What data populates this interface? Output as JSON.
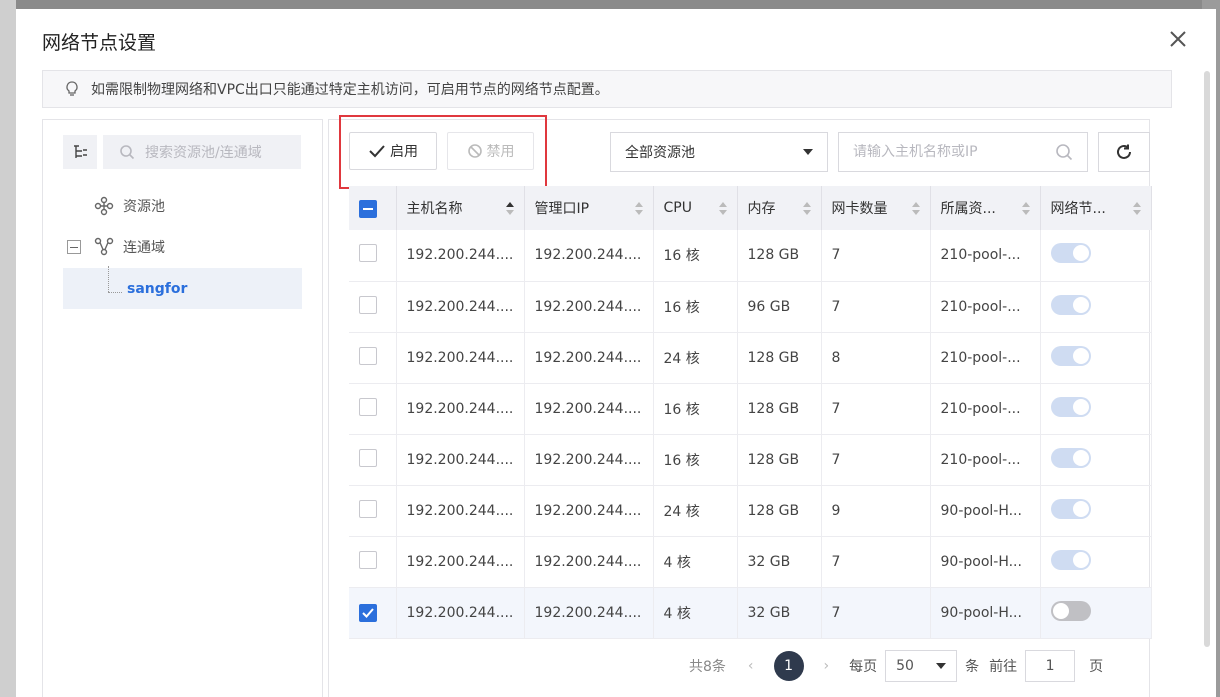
{
  "dialog": {
    "title": "网络节点设置",
    "notice": "如需限制物理网络和VPC出口只能通过特定主机访问，可启用节点的网络节点配置。"
  },
  "tree": {
    "search_placeholder": "搜索资源池/连通域",
    "items": [
      {
        "label": "资源池",
        "icon": "resource-pool-icon"
      },
      {
        "label": "连通域",
        "icon": "connectivity-domain-icon"
      },
      {
        "label": "sangfor",
        "selected": true
      }
    ]
  },
  "toolbar": {
    "enable_label": "启用",
    "disable_label": "禁用",
    "pool_select": "全部资源池",
    "search_placeholder": "请输入主机名称或IP"
  },
  "table": {
    "columns": [
      "主机名称",
      "管理口IP",
      "CPU",
      "内存",
      "网卡数量",
      "所属资...",
      "网络节..."
    ],
    "rows": [
      {
        "host": "192.200.244....",
        "ip": "192.200.244....",
        "cpu": "16 核",
        "mem": "128 GB",
        "nic": "7",
        "pool": "210-pool-...",
        "enabled": true,
        "checked": false
      },
      {
        "host": "192.200.244....",
        "ip": "192.200.244....",
        "cpu": "16 核",
        "mem": "96 GB",
        "nic": "7",
        "pool": "210-pool-...",
        "enabled": true,
        "checked": false
      },
      {
        "host": "192.200.244....",
        "ip": "192.200.244....",
        "cpu": "24 核",
        "mem": "128 GB",
        "nic": "8",
        "pool": "210-pool-...",
        "enabled": true,
        "checked": false
      },
      {
        "host": "192.200.244....",
        "ip": "192.200.244....",
        "cpu": "16 核",
        "mem": "128 GB",
        "nic": "7",
        "pool": "210-pool-...",
        "enabled": true,
        "checked": false
      },
      {
        "host": "192.200.244....",
        "ip": "192.200.244....",
        "cpu": "16 核",
        "mem": "128 GB",
        "nic": "7",
        "pool": "210-pool-...",
        "enabled": true,
        "checked": false
      },
      {
        "host": "192.200.244....",
        "ip": "192.200.244....",
        "cpu": "24 核",
        "mem": "128 GB",
        "nic": "9",
        "pool": "90-pool-H...",
        "enabled": true,
        "checked": false
      },
      {
        "host": "192.200.244....",
        "ip": "192.200.244....",
        "cpu": "4 核",
        "mem": "32 GB",
        "nic": "7",
        "pool": "90-pool-H...",
        "enabled": true,
        "checked": false
      },
      {
        "host": "192.200.244....",
        "ip": "192.200.244....",
        "cpu": "4 核",
        "mem": "32 GB",
        "nic": "7",
        "pool": "90-pool-H...",
        "enabled": false,
        "checked": true
      }
    ]
  },
  "pager": {
    "total": "共8条",
    "current_page": "1",
    "per_page_label": "每页",
    "page_size": "50",
    "unit_label": "条",
    "goto_label": "前往",
    "goto_value": "1",
    "page_suffix": "页"
  },
  "colors": {
    "accent": "#2b6fdc",
    "highlight": "#e0383e",
    "pager_active": "#2f3a4d"
  }
}
